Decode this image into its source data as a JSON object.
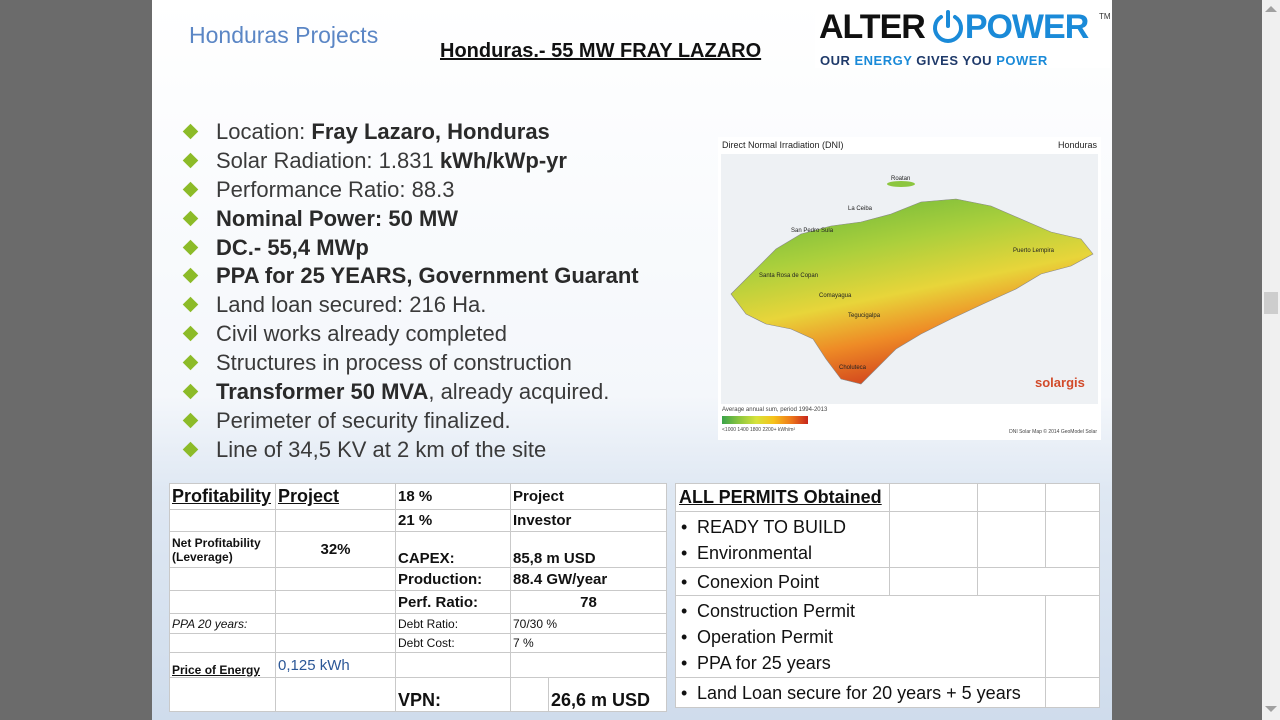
{
  "header": {
    "section": "Honduras Projects",
    "title": "Honduras.-  55 MW FRAY LAZARO"
  },
  "logo": {
    "alter": "ALTER",
    "power": "POWER",
    "tm": "TM",
    "tagline_1": "OUR ",
    "tagline_2": "ENERGY",
    "tagline_3": " GIVES YOU ",
    "tagline_4": "POWER"
  },
  "bullets": [
    {
      "plain": "Location:  ",
      "bold": "Fray Lazaro, Honduras",
      "tail": ""
    },
    {
      "plain": "Solar Radiation: 1.831 ",
      "bold": "kWh/kWp-yr",
      "tail": ""
    },
    {
      "plain": "Performance Ratio: 88.3",
      "bold": "",
      "tail": ""
    },
    {
      "plain": "",
      "bold": "Nominal Power:  50 MW",
      "tail": ""
    },
    {
      "plain": "",
      "bold": "DC.- 55,4 MWp",
      "tail": ""
    },
    {
      "plain": "",
      "bold": "PPA for 25 YEARS, Government Guarant",
      "tail": ""
    },
    {
      "plain": "Land loan secured: 216 Ha.",
      "bold": "",
      "tail": ""
    },
    {
      "plain": "Civil works already completed",
      "bold": "",
      "tail": ""
    },
    {
      "plain": "Structures in process of construction",
      "bold": "",
      "tail": ""
    },
    {
      "plain": "",
      "bold": "Transformer 50 MVA",
      "tail": ", already acquired."
    },
    {
      "plain": "Perimeter of security finalized.",
      "bold": "",
      "tail": ""
    },
    {
      "plain": "Line of 34,5 KV at 2 km of the site",
      "bold": "",
      "tail": ""
    }
  ],
  "map": {
    "title": "Direct Normal Irradiation (DNI)",
    "country": "Honduras",
    "brand": "solargis",
    "cities": [
      "Roatan",
      "La Ceiba",
      "San Pedro Sula",
      "Puerto Lempira",
      "Santa Rosa de Copan",
      "Comayagua",
      "Tegucigalpa",
      "Choluteca"
    ],
    "scale_label": "Average annual sum, period 1994-2013",
    "scale_ticks": "<1000   1400   1800   2200+ kWh/m²",
    "footer": "DNI Solar Map © 2014 GeoModel Solar"
  },
  "profit": {
    "heading_a": "Profitability",
    "heading_b": "Project",
    "r1_pct": "18 %",
    "r1_label": "Project",
    "r2_pct": "21 %",
    "r2_label": "Investor",
    "net_label": "Net Profitability (Leverage)",
    "net_value": "32%",
    "capex_label": "CAPEX:",
    "capex_value": "85,8 m USD",
    "prod_label": "Production:",
    "prod_value": "88.4 GW/year",
    "pr_label": "Perf. Ratio:",
    "pr_value": "78",
    "ppa_label": "PPA 20 years:",
    "debt_ratio_label": "Debt Ratio:",
    "debt_ratio_value": "70/30 %",
    "debt_cost_label": "Debt Cost:",
    "debt_cost_value": "7 %",
    "price_label": "Price of Energy",
    "price_value": "0,125 kWh",
    "vpn_label": "VPN:",
    "vpn_value": "26,6 m USD"
  },
  "permits": {
    "heading": "ALL PERMITS Obtained",
    "items": [
      "READY TO BUILD",
      "Environmental",
      "Conexion Point",
      "Construction Permit",
      "Operation Permit",
      "PPA for 25 years",
      "Land Loan secure for 20 years + 5 years"
    ]
  }
}
